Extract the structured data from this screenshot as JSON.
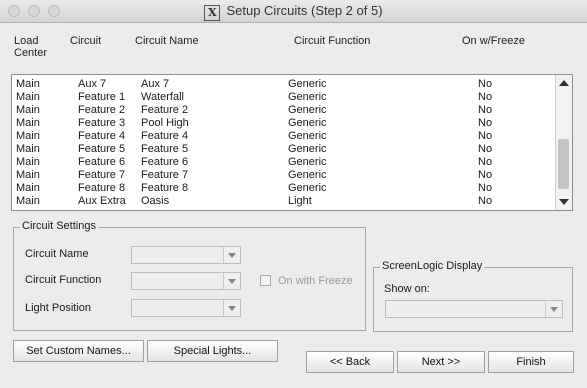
{
  "window": {
    "title": "Setup Circuits (Step 2 of 5)"
  },
  "columns": {
    "load_center_line1": "Load",
    "load_center_line2": "Center",
    "circuit": "Circuit",
    "circuit_name": "Circuit Name",
    "circuit_function": "Circuit Function",
    "on_w_freeze": "On w/Freeze"
  },
  "rows": [
    {
      "load_center": "Main",
      "circuit": "Aux 7",
      "name": "Aux 7",
      "function": "Generic",
      "freeze": "No"
    },
    {
      "load_center": "Main",
      "circuit": "Feature 1",
      "name": "Waterfall",
      "function": "Generic",
      "freeze": "No"
    },
    {
      "load_center": "Main",
      "circuit": "Feature 2",
      "name": "Feature 2",
      "function": "Generic",
      "freeze": "No"
    },
    {
      "load_center": "Main",
      "circuit": "Feature 3",
      "name": "Pool High",
      "function": "Generic",
      "freeze": "No"
    },
    {
      "load_center": "Main",
      "circuit": "Feature 4",
      "name": "Feature 4",
      "function": "Generic",
      "freeze": "No"
    },
    {
      "load_center": "Main",
      "circuit": "Feature 5",
      "name": "Feature 5",
      "function": "Generic",
      "freeze": "No"
    },
    {
      "load_center": "Main",
      "circuit": "Feature 6",
      "name": "Feature 6",
      "function": "Generic",
      "freeze": "No"
    },
    {
      "load_center": "Main",
      "circuit": "Feature 7",
      "name": "Feature 7",
      "function": "Generic",
      "freeze": "No"
    },
    {
      "load_center": "Main",
      "circuit": "Feature 8",
      "name": "Feature 8",
      "function": "Generic",
      "freeze": "No"
    },
    {
      "load_center": "Main",
      "circuit": "Aux Extra",
      "name": "Oasis",
      "function": "Light",
      "freeze": "No"
    }
  ],
  "circuit_settings": {
    "title": "Circuit Settings",
    "circuit_name_label": "Circuit Name",
    "circuit_function_label": "Circuit Function",
    "light_position_label": "Light Position",
    "on_with_freeze_label": "On with Freeze",
    "circuit_name_value": "",
    "circuit_function_value": "",
    "light_position_value": "",
    "on_with_freeze_checked": false
  },
  "screenlogic": {
    "title": "ScreenLogic Display",
    "show_on_label": "Show on:",
    "show_on_value": ""
  },
  "buttons": {
    "set_custom_names": "Set Custom Names...",
    "special_lights": "Special Lights...",
    "back": "<< Back",
    "next": "Next >>",
    "finish": "Finish"
  }
}
